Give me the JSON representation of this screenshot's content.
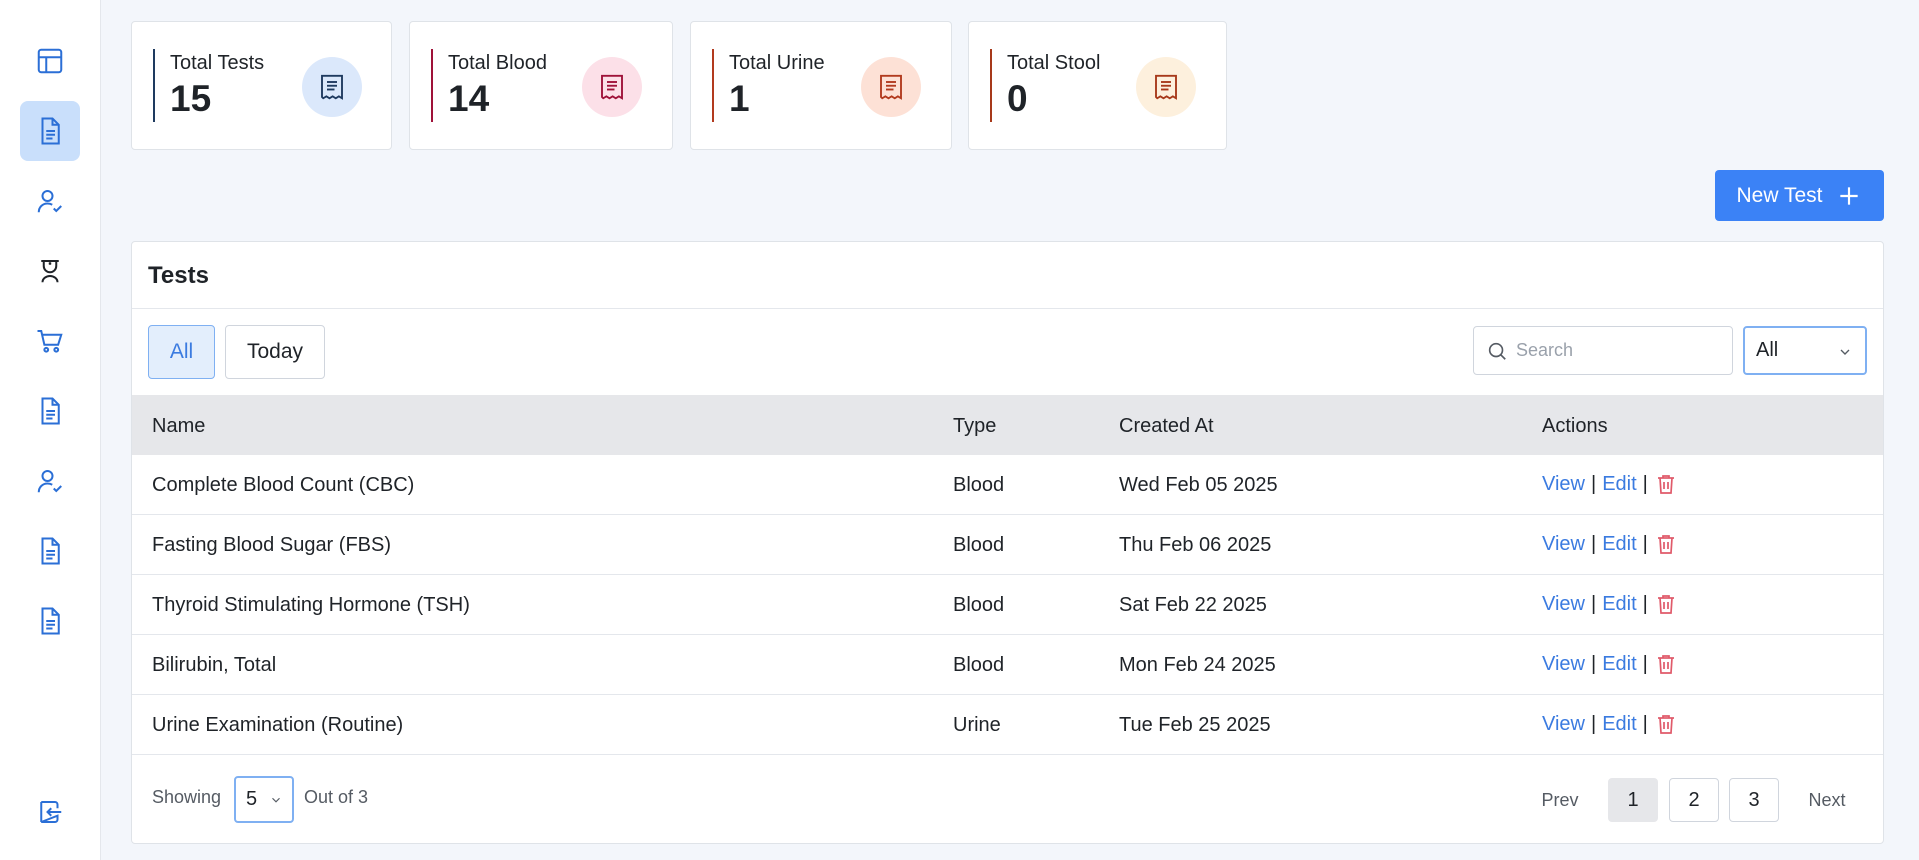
{
  "sidebar": {
    "items": [
      {
        "icon": "dashboard-icon"
      },
      {
        "icon": "document-icon",
        "active": true
      },
      {
        "icon": "user-check-icon"
      },
      {
        "icon": "nurse-icon"
      },
      {
        "icon": "cart-icon"
      },
      {
        "icon": "document-icon"
      },
      {
        "icon": "user-check-icon"
      },
      {
        "icon": "document-icon"
      },
      {
        "icon": "document-icon"
      }
    ],
    "logout_icon": "logout-icon"
  },
  "stats": [
    {
      "label": "Total Tests",
      "value": "15",
      "bar_color": "#1e3a5f",
      "icon_bg": "#dbe8fb",
      "icon_color": "#1e3a5f"
    },
    {
      "label": "Total Blood",
      "value": "14",
      "bar_color": "#9f1239",
      "icon_bg": "#fce0e8",
      "icon_color": "#9f1239"
    },
    {
      "label": "Total Urine",
      "value": "1",
      "bar_color": "#b23a1e",
      "icon_bg": "#fde1d6",
      "icon_color": "#b23a1e"
    },
    {
      "label": "Total Stool",
      "value": "0",
      "bar_color": "#a7391a",
      "icon_bg": "#fdf0dd",
      "icon_color": "#a7391a"
    }
  ],
  "new_test_button": {
    "label": "New Test"
  },
  "tests_card": {
    "title": "Tests",
    "filters": [
      {
        "label": "All",
        "active": true
      },
      {
        "label": "Today",
        "active": false
      }
    ],
    "search_placeholder": "Search",
    "type_select": "All",
    "columns": [
      "Name",
      "Type",
      "Created At",
      "Actions"
    ],
    "rows": [
      {
        "name": "Complete Blood Count (CBC)",
        "type": "Blood",
        "created": "Wed Feb 05 2025"
      },
      {
        "name": "Fasting Blood Sugar (FBS)",
        "type": "Blood",
        "created": "Thu Feb 06 2025"
      },
      {
        "name": "Thyroid Stimulating Hormone (TSH)",
        "type": "Blood",
        "created": "Sat Feb 22 2025"
      },
      {
        "name": "Bilirubin, Total",
        "type": "Blood",
        "created": "Mon Feb 24 2025"
      },
      {
        "name": "Urine Examination (Routine)",
        "type": "Urine",
        "created": "Tue Feb 25 2025"
      }
    ],
    "actions": {
      "view": "View",
      "edit": "Edit",
      "separator": "|",
      "delete_icon": "trash-icon"
    }
  },
  "pagination": {
    "showing_label": "Showing",
    "page_size": "5",
    "out_of_label": "Out of 3",
    "prev": "Prev",
    "next": "Next",
    "pages": [
      "1",
      "2",
      "3"
    ],
    "current_page": "1"
  },
  "colors": {
    "accent": "#3b82f6",
    "link": "#3b7be0",
    "danger": "#e05a6a"
  }
}
